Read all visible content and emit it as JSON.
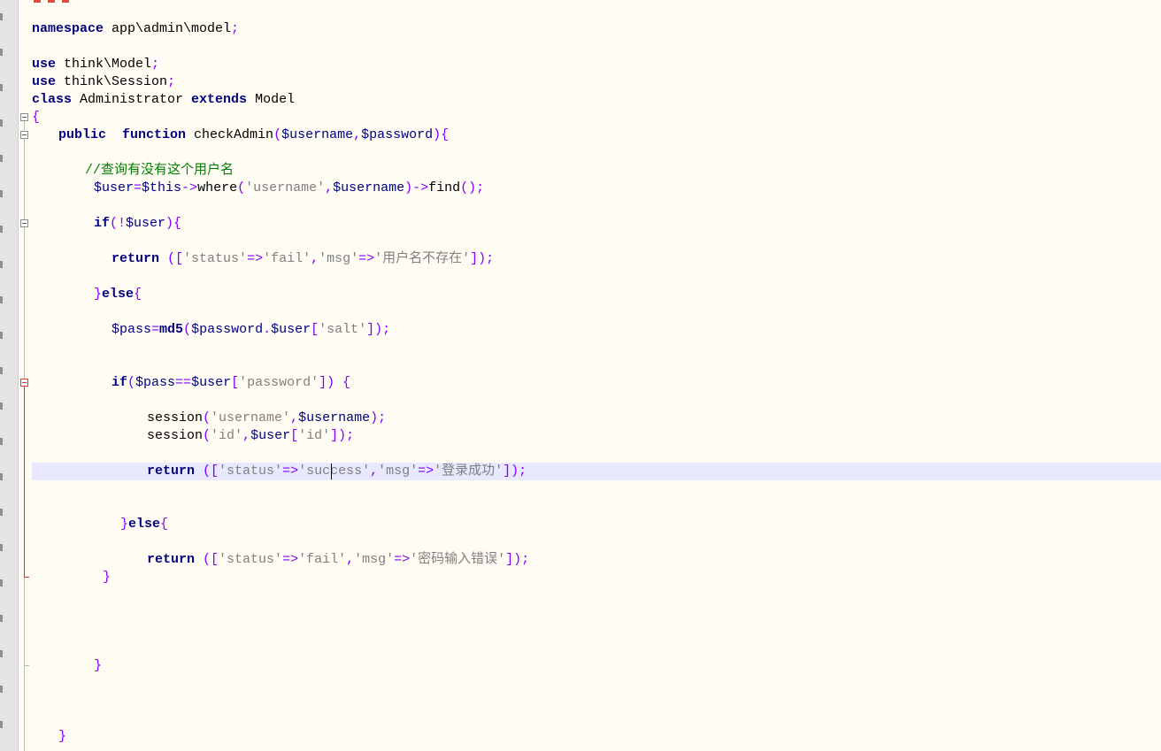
{
  "editor": {
    "language": "PHP",
    "current_line_index": 17,
    "colors": {
      "background": "#fffcf3",
      "keyword": "#000080",
      "operator": "#8000ff",
      "string": "#808080",
      "comment": "#008000",
      "current_line": "#e8e8ff",
      "fold_marker_active": "#e03030"
    },
    "icons": {
      "fold_marker": "fold-collapse-icon",
      "text_caret": "caret-icon"
    },
    "lines": [
      {
        "tokens": [
          {
            "t": "kw",
            "v": "namespace"
          },
          {
            "t": "id",
            "v": " app\\admin\\model"
          },
          {
            "t": "op",
            "v": ";"
          }
        ]
      },
      {
        "tokens": [
          {
            "t": "kw",
            "v": "use"
          },
          {
            "t": "id",
            "v": " think\\Model"
          },
          {
            "t": "op",
            "v": ";"
          }
        ]
      },
      {
        "tokens": [
          {
            "t": "kw",
            "v": "use"
          },
          {
            "t": "id",
            "v": " think\\Session"
          },
          {
            "t": "op",
            "v": ";"
          }
        ]
      },
      {
        "tokens": [
          {
            "t": "kw",
            "v": "class"
          },
          {
            "t": "id",
            "v": " Administrator "
          },
          {
            "t": "kw",
            "v": "extends"
          },
          {
            "t": "id",
            "v": " Model"
          }
        ]
      },
      {
        "tokens": [
          {
            "t": "op",
            "v": "{"
          }
        ]
      },
      {
        "tokens": [
          {
            "t": "kw",
            "v": "public"
          },
          {
            "t": "id",
            "v": "  "
          },
          {
            "t": "kw",
            "v": "function"
          },
          {
            "t": "id",
            "v": " checkAdmin"
          },
          {
            "t": "op",
            "v": "("
          },
          {
            "t": "var",
            "v": "$username"
          },
          {
            "t": "op",
            "v": ","
          },
          {
            "t": "var",
            "v": "$password"
          },
          {
            "t": "op",
            "v": "){"
          }
        ]
      },
      {
        "tokens": [
          {
            "t": "cm",
            "v": "//查询有没有这个用户名"
          }
        ]
      },
      {
        "tokens": [
          {
            "t": "var",
            "v": "$user"
          },
          {
            "t": "op",
            "v": "="
          },
          {
            "t": "var",
            "v": "$this"
          },
          {
            "t": "op",
            "v": "->"
          },
          {
            "t": "id",
            "v": "where"
          },
          {
            "t": "op",
            "v": "("
          },
          {
            "t": "str",
            "v": "'username'"
          },
          {
            "t": "op",
            "v": ","
          },
          {
            "t": "var",
            "v": "$username"
          },
          {
            "t": "op",
            "v": ")->"
          },
          {
            "t": "id",
            "v": "find"
          },
          {
            "t": "op",
            "v": "();"
          }
        ]
      },
      {
        "tokens": [
          {
            "t": "kw",
            "v": "if"
          },
          {
            "t": "op",
            "v": "(!"
          },
          {
            "t": "var",
            "v": "$user"
          },
          {
            "t": "op",
            "v": "){"
          }
        ]
      },
      {
        "tokens": [
          {
            "t": "kw",
            "v": "return"
          },
          {
            "t": "id",
            "v": " "
          },
          {
            "t": "op",
            "v": "(["
          },
          {
            "t": "str",
            "v": "'status'"
          },
          {
            "t": "op",
            "v": "=>"
          },
          {
            "t": "str",
            "v": "'fail'"
          },
          {
            "t": "op",
            "v": ","
          },
          {
            "t": "str",
            "v": "'msg'"
          },
          {
            "t": "op",
            "v": "=>"
          },
          {
            "t": "str",
            "v": "'用户名不存在'"
          },
          {
            "t": "op",
            "v": "]);"
          }
        ]
      },
      {
        "tokens": [
          {
            "t": "op",
            "v": "}"
          },
          {
            "t": "kw",
            "v": "else"
          },
          {
            "t": "op",
            "v": "{"
          }
        ]
      },
      {
        "tokens": [
          {
            "t": "var",
            "v": "$pass"
          },
          {
            "t": "op",
            "v": "="
          },
          {
            "t": "kw",
            "v": "md5"
          },
          {
            "t": "op",
            "v": "("
          },
          {
            "t": "var",
            "v": "$password"
          },
          {
            "t": "op",
            "v": "."
          },
          {
            "t": "var",
            "v": "$user"
          },
          {
            "t": "op",
            "v": "["
          },
          {
            "t": "str",
            "v": "'salt'"
          },
          {
            "t": "op",
            "v": "]);"
          }
        ]
      },
      {
        "tokens": [
          {
            "t": "kw",
            "v": "if"
          },
          {
            "t": "op",
            "v": "("
          },
          {
            "t": "var",
            "v": "$pass"
          },
          {
            "t": "op",
            "v": "=="
          },
          {
            "t": "var",
            "v": "$user"
          },
          {
            "t": "op",
            "v": "["
          },
          {
            "t": "str",
            "v": "'password'"
          },
          {
            "t": "op",
            "v": "]) {"
          }
        ]
      },
      {
        "tokens": [
          {
            "t": "id",
            "v": "session"
          },
          {
            "t": "op",
            "v": "("
          },
          {
            "t": "str",
            "v": "'username'"
          },
          {
            "t": "op",
            "v": ","
          },
          {
            "t": "var",
            "v": "$username"
          },
          {
            "t": "op",
            "v": ");"
          }
        ]
      },
      {
        "tokens": [
          {
            "t": "id",
            "v": "session"
          },
          {
            "t": "op",
            "v": "("
          },
          {
            "t": "str",
            "v": "'id'"
          },
          {
            "t": "op",
            "v": ","
          },
          {
            "t": "var",
            "v": "$user"
          },
          {
            "t": "op",
            "v": "["
          },
          {
            "t": "str",
            "v": "'id'"
          },
          {
            "t": "op",
            "v": "]);"
          }
        ]
      },
      {
        "tokens": [
          {
            "t": "kw",
            "v": "return"
          },
          {
            "t": "id",
            "v": " "
          },
          {
            "t": "op",
            "v": "(["
          },
          {
            "t": "str",
            "v": "'status'"
          },
          {
            "t": "op",
            "v": "=>"
          },
          {
            "t": "str",
            "v": "'success'"
          },
          {
            "t": "op",
            "v": ","
          },
          {
            "t": "str",
            "v": "'msg'"
          },
          {
            "t": "op",
            "v": "=>"
          },
          {
            "t": "str",
            "v": "'登录成功'"
          },
          {
            "t": "op",
            "v": "]);"
          }
        ]
      },
      {
        "tokens": [
          {
            "t": "op",
            "v": "}"
          },
          {
            "t": "kw",
            "v": "else"
          },
          {
            "t": "op",
            "v": "{"
          }
        ]
      },
      {
        "tokens": [
          {
            "t": "kw",
            "v": "return"
          },
          {
            "t": "id",
            "v": " "
          },
          {
            "t": "op",
            "v": "(["
          },
          {
            "t": "str",
            "v": "'status'"
          },
          {
            "t": "op",
            "v": "=>"
          },
          {
            "t": "str",
            "v": "'fail'"
          },
          {
            "t": "op",
            "v": ","
          },
          {
            "t": "str",
            "v": "'msg'"
          },
          {
            "t": "op",
            "v": "=>"
          },
          {
            "t": "str",
            "v": "'密码输入错误'"
          },
          {
            "t": "op",
            "v": "]);"
          }
        ]
      },
      {
        "tokens": [
          {
            "t": "op",
            "v": "}"
          }
        ]
      },
      {
        "tokens": [
          {
            "t": "op",
            "v": "}"
          }
        ]
      },
      {
        "tokens": [
          {
            "t": "op",
            "v": "}"
          }
        ]
      }
    ]
  }
}
